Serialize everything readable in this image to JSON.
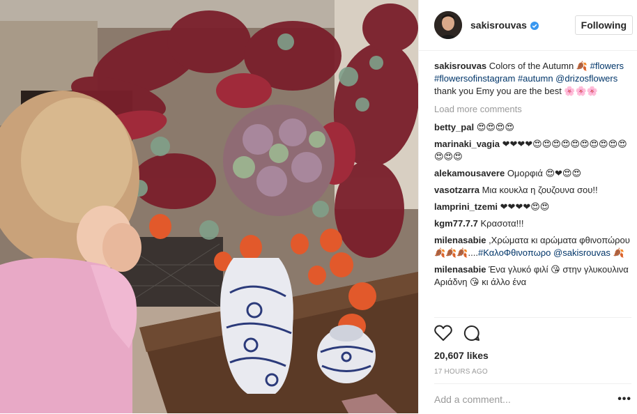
{
  "post": {
    "username": "sakisrouvas",
    "follow_label": "Following",
    "caption": {
      "text_1": "Colors of the Autumn 🍂",
      "tag_1": "#flowers",
      "tag_2": "#flowersofinstagram",
      "tag_3": "#autumn",
      "mention": "@drizosflowers",
      "text_2": "thank you Emy you are the best 🌸🌸🌸"
    },
    "load_more": "Load more comments",
    "comments": [
      {
        "user": "betty_pal",
        "text": "😍😍😍😍"
      },
      {
        "user": "marinaki_vagia",
        "text": "❤❤❤❤😍😍😍😍😍😍😍😍😍😍😍😍😍"
      },
      {
        "user": "alekamousavere",
        "text": "Ομορφιά 😍❤😍😍"
      },
      {
        "user": "vasotzarra",
        "text": "Μια κουκλα η ζουζουνα σου!!"
      },
      {
        "user": "lamprini_tzemi",
        "text": "❤❤❤❤😍😍"
      },
      {
        "user": "kgm77.7.7",
        "text": "Κρασοτα!!!"
      },
      {
        "user": "milenasabie",
        "text": ",Χρώματα κι αρώματα φθινοπώρου 🍂🍂🍂....",
        "tag": "#ΚαλοΦθινοπωρο",
        "mention": "@sakisrouvas",
        "tail": "🍂"
      },
      {
        "user": "milenasabie",
        "text": "Ένα γλυκό φιλί 😘 στην γλυκουλινα Αριάδνη 😘 κι άλλο ένα"
      }
    ],
    "likes": "20,607 likes",
    "time": "17 HOURS AGO",
    "comment_placeholder": "Add a comment...",
    "more_options": "•••"
  },
  "colors": {
    "link": "#003569",
    "muted": "#999999",
    "verified": "#3897f0",
    "border": "#efefef"
  },
  "icons": [
    "heart-icon",
    "comment-icon",
    "verified-badge-icon",
    "more-options-icon"
  ]
}
